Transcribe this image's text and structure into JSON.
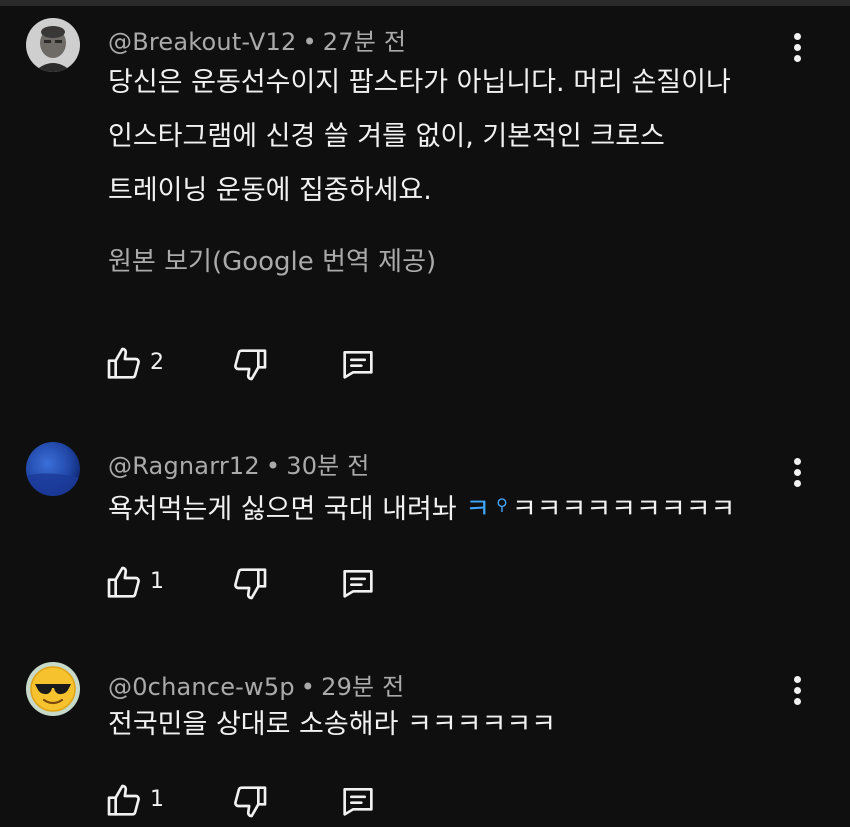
{
  "comments": [
    {
      "handle": "@Breakout-V12",
      "separator": "•",
      "time": "27분 전",
      "text_lines": [
        "당신은 운동선수이지 팝스타가 아닙니다. 머리 손질이나",
        "인스타그램에 신경 쓸 겨를 없이, 기본적인 크로스",
        "트레이닝 운동에 집중하세요."
      ],
      "translate_label": "원본 보기(Google 번역 제공)",
      "likes": "2",
      "avatar_icon": "profile-photo-man-icon"
    },
    {
      "handle": "@Ragnarr12",
      "separator": "•",
      "time": "30분 전",
      "text_prefix": "욕처먹는게 싫으면 국대 내려놔 ",
      "hashtag": "ㅋ",
      "hashtag_icon": "search-icon",
      "text_suffix": "ㅋㅋㅋㅋㅋㅋㅋㅋㅋ",
      "likes": "1",
      "avatar_icon": "blue-gradient-avatar-icon"
    },
    {
      "handle": "@0chance-w5p",
      "separator": "•",
      "time": "29분 전",
      "text": "전국민을 상대로 소송해라 ㅋㅋㅋㅋㅋㅋ",
      "likes": "1",
      "avatar_icon": "sunglasses-emoji-icon"
    }
  ],
  "icons": {
    "like": "thumbs-up-icon",
    "dislike": "thumbs-down-icon",
    "reply": "reply-comment-icon",
    "more": "more-vertical-icon"
  },
  "colors": {
    "background": "#0f0f0f",
    "text": "#f1f1f1",
    "secondary_text": "#aaaaaa",
    "hashtag": "#3ea6ff"
  }
}
